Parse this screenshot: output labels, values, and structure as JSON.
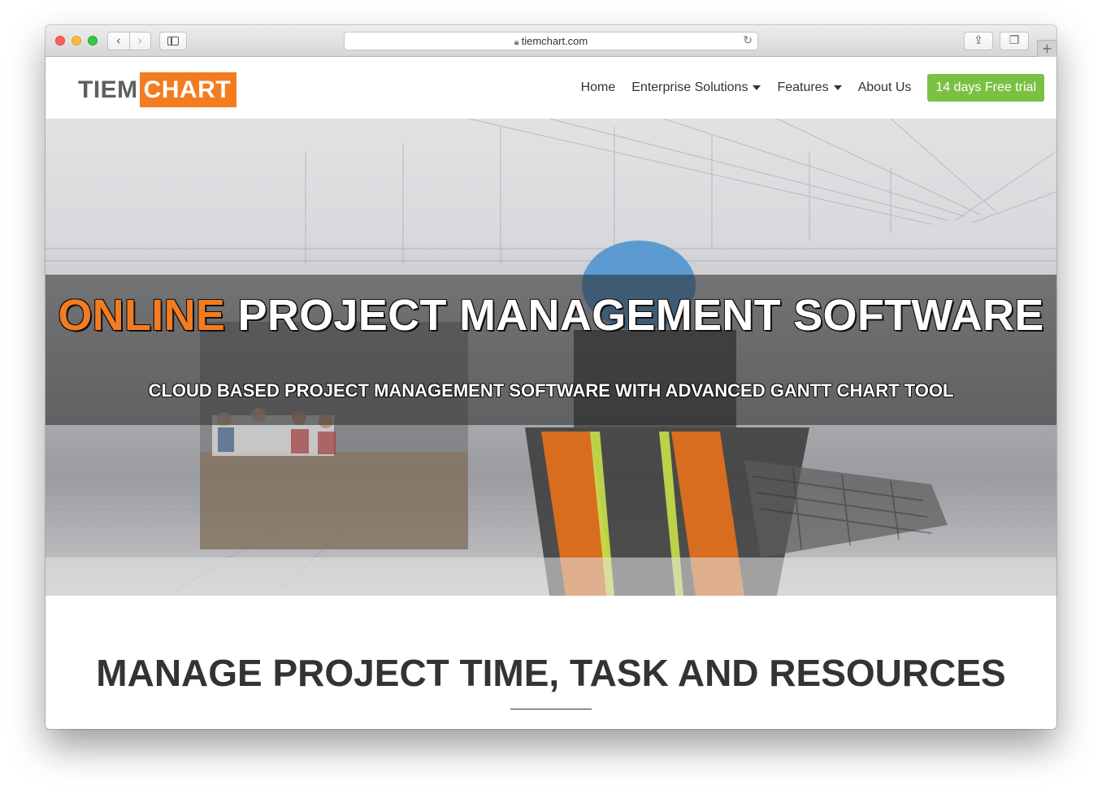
{
  "browser": {
    "url": "tiemchart.com",
    "back_icon": "chevron-left-icon",
    "forward_icon": "chevron-right-icon",
    "sidebar_icon": "sidebar-icon",
    "lock_icon": "lock-icon",
    "reload_icon": "reload-icon",
    "share_icon": "share-icon",
    "tabs_icon": "tabs-overview-icon",
    "new_tab_icon": "plus-icon"
  },
  "site": {
    "logo_part1": "TIEM",
    "logo_part2": "CHART",
    "nav": {
      "home": "Home",
      "enterprise": "Enterprise Solutions",
      "features": "Features",
      "about": "About Us",
      "cta": "14 days Free trial"
    }
  },
  "hero": {
    "title_accent": "ONLINE",
    "title_rest": "PROJECT MANAGEMENT SOFTWARE",
    "subtitle": "CLOUD BASED PROJECT MANAGEMENT SOFTWARE WITH ADVANCED GANTT CHART TOOL"
  },
  "section": {
    "title": "MANAGE PROJECT TIME, TASK AND RESOURCES"
  },
  "colors": {
    "brand_orange": "#f47c20",
    "cta_green": "#7ac143",
    "text_dark": "#333333"
  }
}
